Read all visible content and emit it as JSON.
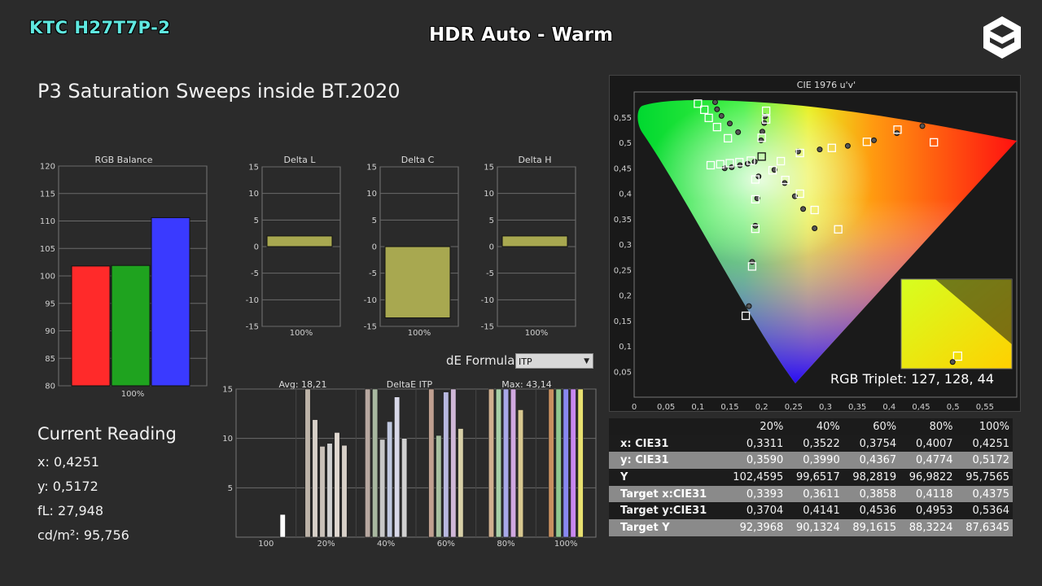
{
  "header": {
    "brand": "KTC H27T7P-2",
    "mode": "HDR Auto - Warm"
  },
  "heading": "P3 Saturation Sweeps inside BT.2020",
  "current_reading": {
    "title": "Current Reading",
    "lines": [
      "x: 0,4251",
      "y: 0,5172",
      "fL: 27,948",
      "cd/m²: 95,756"
    ]
  },
  "formula": {
    "label": "dE Formula:",
    "value": "ITP"
  },
  "triplet": "RGB Triplet: 127, 128, 44",
  "chart_data": [
    {
      "type": "bar",
      "title": "RGB Balance",
      "categories": [
        "100%"
      ],
      "series": [
        {
          "values": [
            101.8
          ],
          "color": "#ff2a2a"
        },
        {
          "values": [
            101.9
          ],
          "color": "#1fa31f"
        },
        {
          "values": [
            110.6
          ],
          "color": "#3a3aff"
        }
      ],
      "ylim": [
        80,
        120
      ],
      "yticks": [
        80,
        85,
        90,
        95,
        100,
        105,
        110,
        115,
        120
      ],
      "grid": true
    },
    {
      "type": "bar",
      "title": "Delta L",
      "categories": [
        "100%"
      ],
      "values": [
        2
      ],
      "ylim": [
        -15,
        15
      ],
      "yticks": [
        -15,
        -10,
        -5,
        0,
        5,
        10,
        15
      ],
      "color": "#a8a850"
    },
    {
      "type": "bar",
      "title": "Delta C",
      "categories": [
        "100%"
      ],
      "values": [
        -13.4
      ],
      "ylim": [
        -15,
        15
      ],
      "yticks": [
        -15,
        -10,
        -5,
        0,
        5,
        10,
        15
      ],
      "color": "#a8a850"
    },
    {
      "type": "bar",
      "title": "Delta H",
      "categories": [
        "100%"
      ],
      "values": [
        2
      ],
      "ylim": [
        -15,
        15
      ],
      "yticks": [
        -15,
        -10,
        -5,
        0,
        5,
        10,
        15
      ],
      "color": "#a8a850"
    },
    {
      "type": "bar",
      "title": "DeltaE ITP",
      "annotations": [
        "Avg: 18,21",
        "Max: 43,14"
      ],
      "categories": [
        "100",
        "20%",
        "40%",
        "60%",
        "80%",
        "100%"
      ],
      "groups": [
        [
          2.3
        ],
        [
          15,
          11.9,
          9.2,
          9.5,
          10.6,
          9.3
        ],
        [
          15,
          15,
          9.9,
          11.7,
          14.2,
          10
        ],
        [
          15,
          10.3,
          14.7,
          15,
          11
        ],
        [
          15,
          15,
          15,
          15,
          12.9
        ],
        [
          15,
          15,
          15,
          15,
          15
        ]
      ],
      "ylim": [
        0,
        15
      ],
      "yticks": [
        5,
        10,
        15
      ]
    },
    {
      "type": "scatter",
      "title": "CIE 1976 u'v'",
      "xlim": [
        0,
        0.6
      ],
      "ylim": [
        0,
        0.6
      ],
      "xticks": [
        "0",
        "0,05",
        "0,1",
        "0,15",
        "0,2",
        "0,25",
        "0,3",
        "0,35",
        "0,4",
        "0,45",
        "0,5",
        "0,55"
      ],
      "yticks": [
        "0,05",
        "0,1",
        "0,15",
        "0,2",
        "0,25",
        "0,3",
        "0,35",
        "0,4",
        "0,45",
        "0,5",
        "0,55"
      ],
      "targets": [
        [
          0.1,
          0.577
        ],
        [
          0.11,
          0.565
        ],
        [
          0.117,
          0.549
        ],
        [
          0.13,
          0.531
        ],
        [
          0.147,
          0.509
        ],
        [
          0.207,
          0.563
        ],
        [
          0.207,
          0.546
        ],
        [
          0.2,
          0.51
        ],
        [
          0.2,
          0.473
        ],
        [
          0.47,
          0.501
        ],
        [
          0.413,
          0.526
        ],
        [
          0.365,
          0.502
        ],
        [
          0.31,
          0.49
        ],
        [
          0.26,
          0.48
        ],
        [
          0.23,
          0.464
        ],
        [
          0.12,
          0.456
        ],
        [
          0.135,
          0.458
        ],
        [
          0.15,
          0.46
        ],
        [
          0.165,
          0.462
        ],
        [
          0.183,
          0.465
        ],
        [
          0.19,
          0.428
        ],
        [
          0.19,
          0.389
        ],
        [
          0.19,
          0.331
        ],
        [
          0.185,
          0.257
        ],
        [
          0.175,
          0.16
        ],
        [
          0.217,
          0.446
        ],
        [
          0.237,
          0.427
        ],
        [
          0.26,
          0.4
        ],
        [
          0.283,
          0.368
        ],
        [
          0.32,
          0.33
        ]
      ],
      "measured": [
        [
          0.127,
          0.58
        ],
        [
          0.13,
          0.566
        ],
        [
          0.137,
          0.553
        ],
        [
          0.15,
          0.538
        ],
        [
          0.163,
          0.521
        ],
        [
          0.205,
          0.552
        ],
        [
          0.204,
          0.539
        ],
        [
          0.201,
          0.522
        ],
        [
          0.199,
          0.505
        ],
        [
          0.452,
          0.533
        ],
        [
          0.412,
          0.519
        ],
        [
          0.376,
          0.505
        ],
        [
          0.335,
          0.494
        ],
        [
          0.291,
          0.487
        ],
        [
          0.257,
          0.483
        ],
        [
          0.142,
          0.45
        ],
        [
          0.153,
          0.452
        ],
        [
          0.166,
          0.456
        ],
        [
          0.178,
          0.459
        ],
        [
          0.189,
          0.463
        ],
        [
          0.195,
          0.434
        ],
        [
          0.193,
          0.391
        ],
        [
          0.19,
          0.337
        ],
        [
          0.185,
          0.266
        ],
        [
          0.18,
          0.179
        ],
        [
          0.22,
          0.447
        ],
        [
          0.236,
          0.421
        ],
        [
          0.252,
          0.395
        ],
        [
          0.265,
          0.37
        ],
        [
          0.283,
          0.332
        ]
      ],
      "inset": {
        "target": [
          0.51,
          0.14
        ],
        "measured": [
          0.465,
          0.075
        ]
      }
    }
  ],
  "table": {
    "columns": [
      "",
      "20%",
      "40%",
      "60%",
      "80%",
      "100%"
    ],
    "rows": [
      {
        "label": "x: CIE31",
        "values": [
          "0,3311",
          "0,3522",
          "0,3754",
          "0,4007",
          "0,4251"
        ]
      },
      {
        "label": "y: CIE31",
        "values": [
          "0,3590",
          "0,3990",
          "0,4367",
          "0,4774",
          "0,5172"
        ]
      },
      {
        "label": "Y",
        "values": [
          "102,4595",
          "99,6517",
          "98,2819",
          "96,9822",
          "95,7565"
        ]
      },
      {
        "label": "Target x:CIE31",
        "values": [
          "0,3393",
          "0,3611",
          "0,3858",
          "0,4118",
          "0,4375"
        ]
      },
      {
        "label": "Target y:CIE31",
        "values": [
          "0,3704",
          "0,4141",
          "0,4536",
          "0,4953",
          "0,5364"
        ]
      },
      {
        "label": "Target Y",
        "values": [
          "92,3968",
          "90,1324",
          "89,1615",
          "88,3224",
          "87,6345"
        ]
      }
    ]
  }
}
